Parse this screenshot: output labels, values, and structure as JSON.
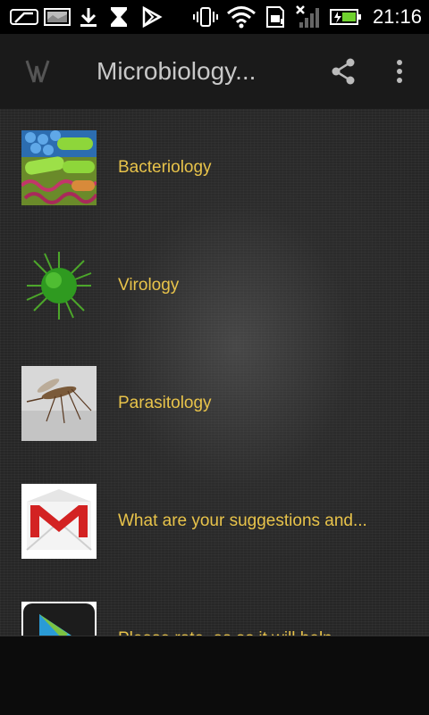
{
  "status_bar": {
    "time": "21:16",
    "icons": [
      "notification-icon",
      "image-icon",
      "download-icon",
      "hourglass-icon",
      "play-store-icon",
      "vibrate-icon",
      "wifi-icon",
      "sd-card-icon",
      "no-signal-icon",
      "battery-charging-icon"
    ]
  },
  "action_bar": {
    "title": "Microbiology...",
    "logo_icon": "app-logo-icon",
    "share_icon": "share-icon",
    "more_icon": "overflow-menu-icon"
  },
  "list": {
    "items": [
      {
        "label": "Bacteriology",
        "icon": "bacteria-image"
      },
      {
        "label": "Virology",
        "icon": "virus-image"
      },
      {
        "label": "Parasitology",
        "icon": "mosquito-image"
      },
      {
        "label": "What are your suggestions and...",
        "icon": "gmail-icon"
      },
      {
        "label": "Please rate, as as it will help",
        "icon": "play-store-icon"
      }
    ]
  },
  "colors": {
    "label": "#e8c34a",
    "action_bar": "#1a1a1a",
    "status_bar": "#000000",
    "title": "#c8c8c8"
  }
}
